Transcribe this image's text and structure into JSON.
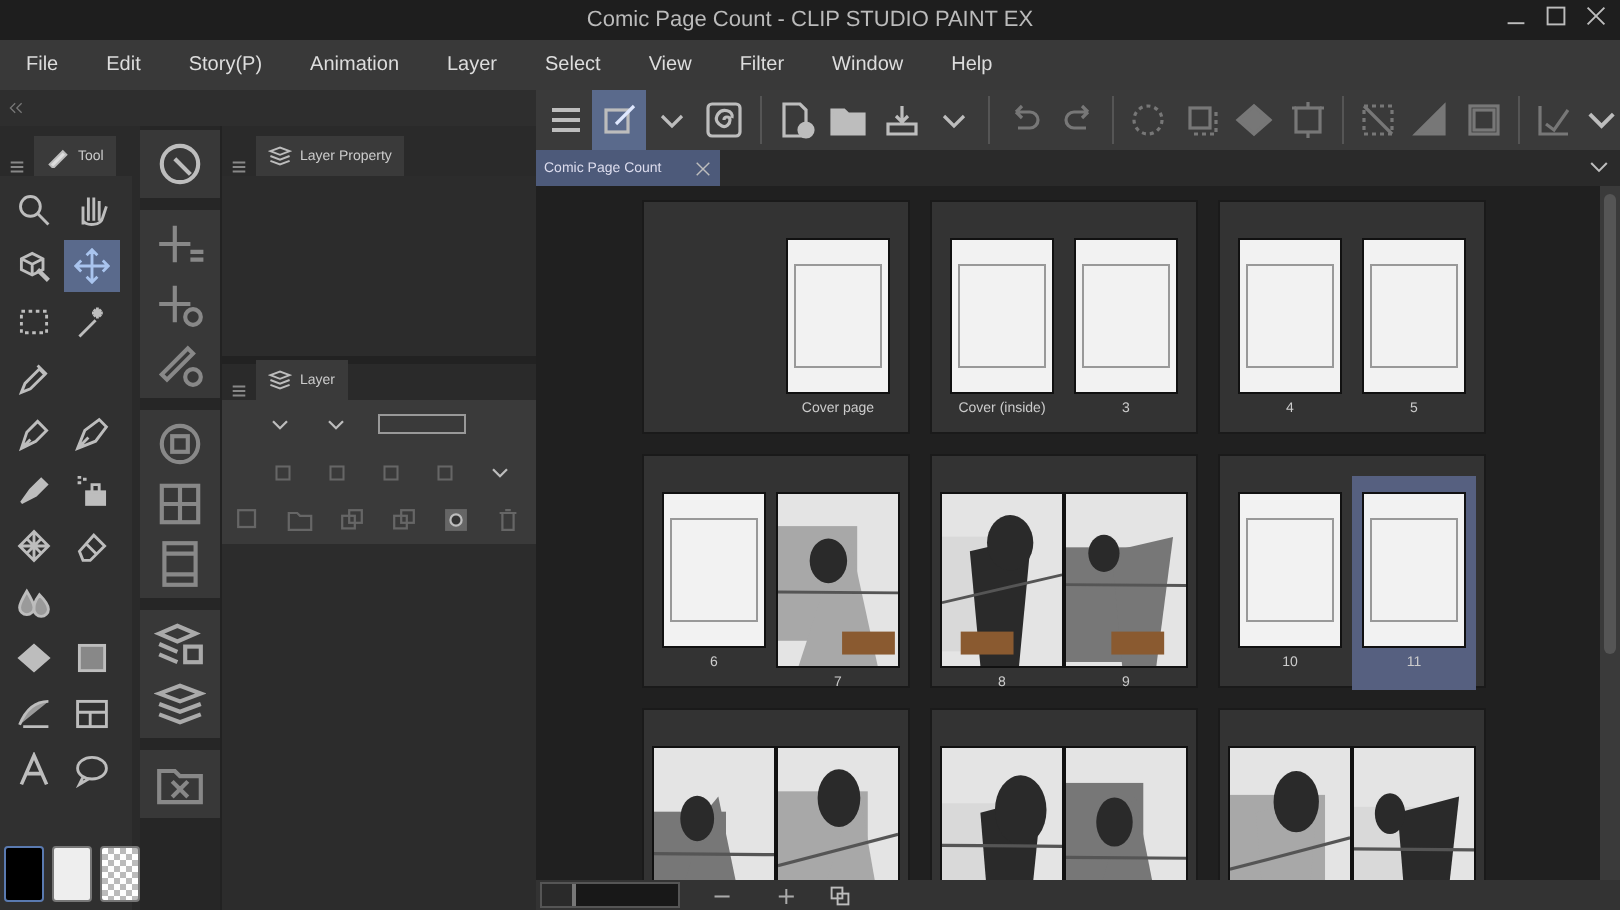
{
  "window": {
    "title": "Comic Page Count - CLIP STUDIO PAINT EX"
  },
  "menu": [
    "File",
    "Edit",
    "Story(P)",
    "Animation",
    "Layer",
    "Select",
    "View",
    "Filter",
    "Window",
    "Help"
  ],
  "tool_panel": {
    "tab": "Tool"
  },
  "tools": [
    {
      "selected": false
    },
    {
      "selected": false
    },
    {
      "selected": false
    },
    {
      "selected": true
    },
    {
      "selected": false
    },
    {
      "selected": false
    },
    {
      "selected": false
    },
    {
      "selected": false
    },
    {
      "selected": false
    },
    {
      "selected": false
    },
    {
      "selected": false
    },
    {
      "selected": false
    },
    {
      "selected": false
    },
    {
      "selected": false
    },
    {
      "selected": false
    },
    {
      "selected": false
    },
    {
      "selected": false
    },
    {
      "selected": false
    },
    {
      "selected": false
    },
    {
      "selected": false
    }
  ],
  "layer_property_panel": {
    "tab": "Layer Property"
  },
  "layer_panel": {
    "tab": "Layer"
  },
  "toolbar": [
    {
      "selected": false
    },
    {
      "selected": true
    }
  ],
  "document_tabs": [
    {
      "label": "Comic Page Count",
      "selected": true
    }
  ],
  "spreads": [
    {
      "pages": [
        {
          "kind": "empty"
        },
        {
          "kind": "blank",
          "label": "Cover page",
          "selected": false
        }
      ]
    },
    {
      "pages": [
        {
          "kind": "blank",
          "label": "Cover (inside)",
          "selected": false
        },
        {
          "kind": "blank",
          "label": "3",
          "selected": false
        }
      ]
    },
    {
      "pages": [
        {
          "kind": "blank",
          "label": "4",
          "selected": false
        },
        {
          "kind": "blank",
          "label": "5",
          "selected": false
        }
      ]
    },
    {
      "pages": [
        {
          "kind": "blank",
          "label": "6",
          "selected": false
        },
        {
          "kind": "picture",
          "label": "7",
          "selected": false
        }
      ]
    },
    {
      "pages": [
        {
          "kind": "picture",
          "label": "8",
          "selected": false
        },
        {
          "kind": "picture",
          "label": "9",
          "selected": false
        }
      ]
    },
    {
      "pages": [
        {
          "kind": "blank",
          "label": "10",
          "selected": false
        },
        {
          "kind": "blank",
          "label": "11",
          "selected": true
        }
      ]
    },
    {
      "pages": [
        {
          "kind": "picture"
        },
        {
          "kind": "picture"
        }
      ]
    },
    {
      "pages": [
        {
          "kind": "picture"
        },
        {
          "kind": "picture"
        }
      ]
    },
    {
      "pages": [
        {
          "kind": "picture"
        },
        {
          "kind": "picture"
        }
      ]
    }
  ],
  "zoom_bar": {
    "level": 0.25,
    "minus": "−",
    "plus": "+"
  }
}
